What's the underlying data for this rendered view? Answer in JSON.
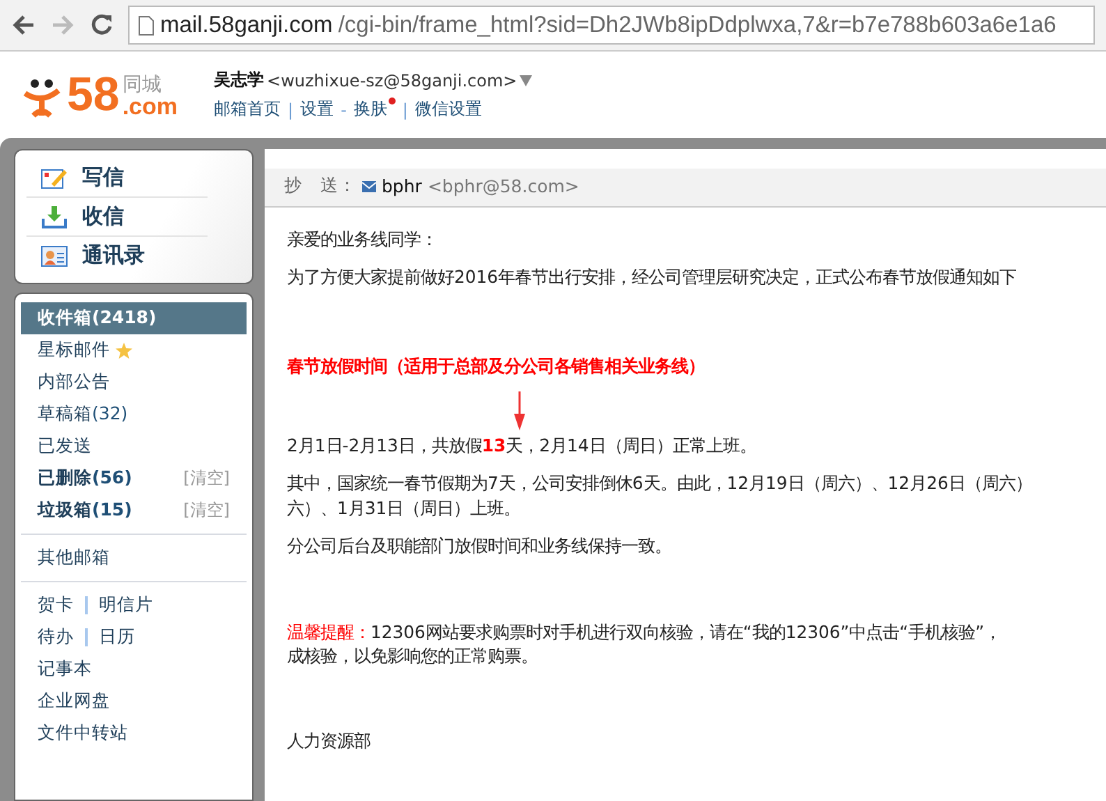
{
  "browser": {
    "url_host": "mail.58ganji.com",
    "url_rest": "/cgi-bin/frame_html?sid=Dh2JWb8ipDdplwxa,7&r=b7e788b603a6e1a6"
  },
  "logo": {
    "number": "58",
    "domain": ".com",
    "brand": "同城"
  },
  "account": {
    "name": "吴志学",
    "email": "<wuzhixue-sz@58ganji.com>",
    "links": [
      {
        "label": "邮箱首页",
        "sep": "|"
      },
      {
        "label": "设置",
        "sep": "-"
      },
      {
        "label": "换肤",
        "new": true,
        "sep": "|"
      },
      {
        "label": "微信设置"
      }
    ]
  },
  "actions": [
    {
      "kind": "compose",
      "label": "写信"
    },
    {
      "kind": "inbox",
      "label": "收信"
    },
    {
      "kind": "contacts",
      "label": "通讯录"
    }
  ],
  "folders": [
    {
      "label": "收件箱",
      "count": "(2418)",
      "unread": true,
      "selected": true
    },
    {
      "label": "星标邮件",
      "kind": "starred",
      "unread": false,
      "selected": false
    },
    {
      "label": "内部公告",
      "unread": false,
      "selected": false
    },
    {
      "label": "草稿箱",
      "count": "(32)",
      "unread": false,
      "selected": false
    },
    {
      "label": "已发送",
      "unread": false,
      "selected": false
    },
    {
      "label": "已删除",
      "count": "(56)",
      "unread": true,
      "selected": false,
      "clear": "[清空]"
    },
    {
      "label": "垃圾箱",
      "count": "(15)",
      "unread": true,
      "selected": false,
      "clear": "[清空]"
    }
  ],
  "other_mailbox": "其他邮箱",
  "tools": [
    [
      "贺卡",
      "明信片"
    ],
    [
      "待办",
      "日历"
    ],
    [
      "记事本"
    ],
    [
      "企业网盘"
    ],
    [
      "文件中转站"
    ]
  ],
  "mail": {
    "cc_label": "抄　送：",
    "cc_name": "bphr",
    "cc_address": "<bphr@58.com>",
    "greeting": "亲爱的业务线同学：",
    "intro": "为了方便大家提前做好2016年春节出行安排，经公司管理层研究决定，正式公布春节放假通知如下",
    "heading": "春节放假时间（适用于总部及分公司各销售相关业务线）",
    "dates": "2月1日-2月13日，共放假**13**天，2月14日（周日）正常上班。",
    "details": [
      "其中，国家统一春节假期为7天，公司安排倒休6天。由此，12月19日（周六）、12月26日（周六）",
      "六）、1月31日（周日）上班。"
    ],
    "branch": "分公司后台及职能部门放假时间和业务线保持一致。",
    "reminder_label": "温馨提醒：",
    "reminder": [
      "12306网站要求购票时对手机进行双向核验，请在“我的12306”中点击“手机核验”，",
      "成核验，以免影响您的正常购票。"
    ],
    "signature": "人力资源部"
  }
}
